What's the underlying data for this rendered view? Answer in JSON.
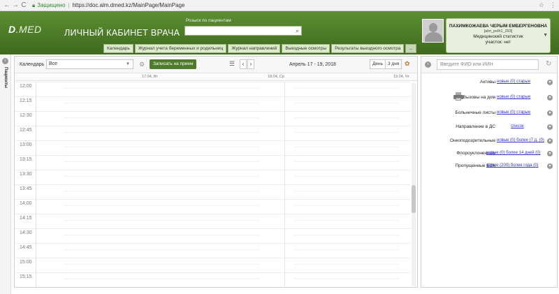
{
  "browser": {
    "back": "←",
    "forward": "→",
    "reload": "C",
    "secure_label": "Защищено",
    "separator": "|",
    "url": "https://doc.alm.dmed.kz/MainPage/MainPage",
    "star": "☆",
    "menu": "⋮"
  },
  "header": {
    "logo_d": "D",
    "logo_rest": ".MED",
    "title": "ЛИЧНЫЙ КАБИНЕТ ВРАЧА",
    "search_label": "Розыск по пациентам",
    "search_value": ""
  },
  "nav": {
    "tabs": [
      "Календарь",
      "Журнал учета беременных и родильниц",
      "Журнал направлений",
      "Выездные осмотры",
      "Результаты выездного осмотра"
    ],
    "more": "..."
  },
  "user": {
    "name": "ПАХИМКОЖАЕВА ЧЕРЫМ ЕМБЕРГЕНОВНА",
    "login": "[alm_polh1_293]",
    "role": "Медицинский статистик",
    "site": "участок: нет"
  },
  "left_strip": {
    "label": "Пациенты"
  },
  "calendar": {
    "label": "Календарь",
    "select_value": "Все",
    "book_button": "Записать на прием",
    "date_range": "Апрель 17 - 19, 2018",
    "view_day": "День",
    "view_3day": "3 дня",
    "days": [
      "17.04, Вт",
      "18.04, Ср",
      "19.04, Чт"
    ],
    "times": [
      "12:00",
      "12:15",
      "12:30",
      "12:45",
      "13:00",
      "13:15",
      "13:30",
      "13:45",
      "14:00",
      "14:15",
      "14:30",
      "14:45",
      "15:00",
      "15:15"
    ]
  },
  "right_panel": {
    "search_placeholder": "Введите ФИО или ИИН",
    "stats": [
      {
        "label": "Активы",
        "links": "новые (0) старые"
      },
      {
        "label": "Вызовы на дом",
        "links": "новые (0) старые"
      },
      {
        "label": "Больничные листы",
        "links": "новые (0) старые"
      },
      {
        "label": "Направление в ДС",
        "links": "список"
      },
      {
        "label": "Онкоподозрительные",
        "links": "новые (0) более (7 д. (0)"
      },
      {
        "label": "Флороуклоненные",
        "links": "новые (0) более 14 дней (0)"
      },
      {
        "label": "Пропущенные БСК",
        "links": "новые (200) более года (0)"
      }
    ]
  }
}
